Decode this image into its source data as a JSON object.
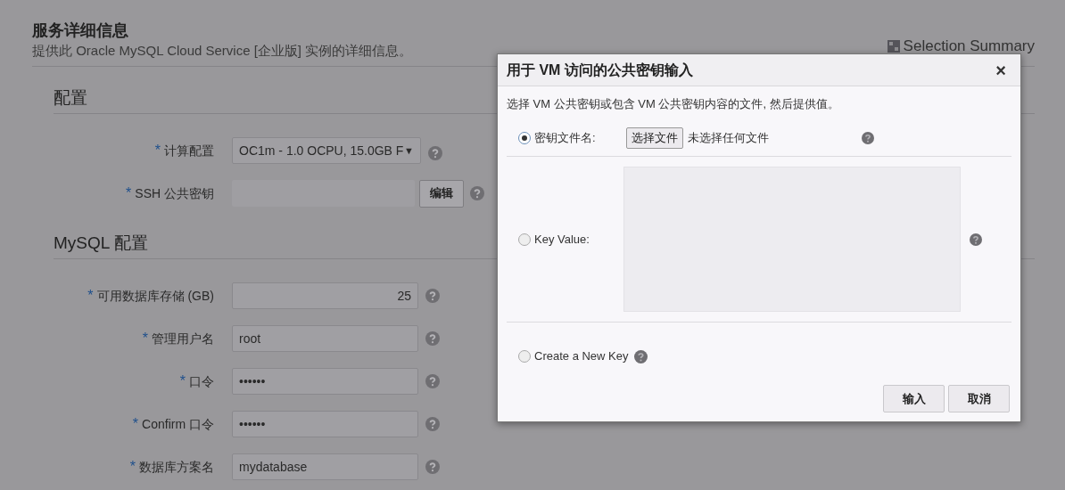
{
  "page": {
    "title": "服务详细信息",
    "subtitle": "提供此 Oracle MySQL Cloud Service [企业版] 实例的详细信息。",
    "selection_summary": "Selection Summary"
  },
  "sections": [
    {
      "title": "配置",
      "fields": [
        {
          "kind": "select",
          "marker": "*",
          "label": "计算配置",
          "value": "OC1m - 1.0 OCPU, 15.0GB F",
          "caret": "▼"
        },
        {
          "kind": "edit",
          "marker": "*",
          "label": "SSH 公共密钥",
          "button": "编辑"
        }
      ]
    },
    {
      "title": "MySQL 配置",
      "fields": [
        {
          "kind": "number",
          "marker": "*",
          "label": "可用数据库存储 (GB)",
          "value": "25"
        },
        {
          "kind": "text",
          "marker": "*",
          "label": "管理用户名",
          "value": "root"
        },
        {
          "kind": "text",
          "marker": "*",
          "label": "口令",
          "value": "••••••"
        },
        {
          "kind": "text",
          "marker": "*",
          "label": "Confirm 口令",
          "value": "••••••"
        },
        {
          "kind": "text",
          "marker": "*",
          "label": "数据库方案名",
          "value": "mydatabase"
        }
      ]
    }
  ],
  "dialog": {
    "title": "用于 VM 访问的公共密钥输入",
    "close": "×",
    "instruction": "选择 VM 公共密钥或包含 VM 公共密钥内容的文件, 然后提供值。",
    "options": [
      {
        "kind": "file",
        "label": "密钥文件名:",
        "selected": true,
        "button": "选择文件",
        "status": "未选择任何文件"
      },
      {
        "kind": "textarea",
        "label": "Key Value:",
        "selected": false
      },
      {
        "kind": "create",
        "label": "Create a New Key",
        "selected": false
      }
    ],
    "buttons": [
      "输入",
      "取消"
    ]
  }
}
